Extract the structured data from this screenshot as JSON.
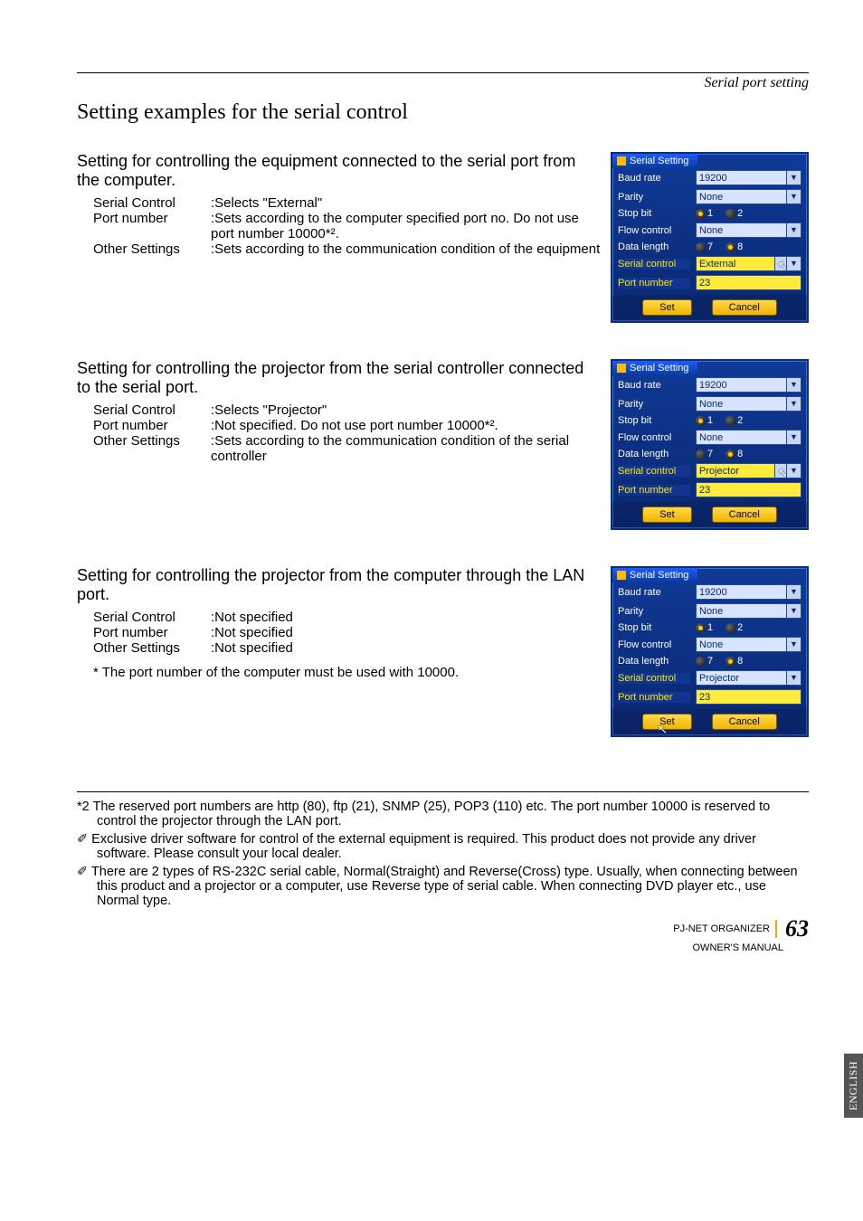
{
  "breadcrumb": "Serial port setting",
  "main_heading": "Setting examples for the serial control",
  "side_tab": "ENGLISH",
  "sections": [
    {
      "heading": "Setting for controlling the equipment connected to the serial port from the computer.",
      "rows": [
        {
          "label": "Serial Control",
          "value": ":Selects \"External\""
        },
        {
          "label": "Port number",
          "value": ":Sets according to the computer specified port no. Do not use port number 10000*²."
        },
        {
          "label": "Other Settings",
          "value": ":Sets according to the communication condition of the equipment"
        }
      ],
      "panel": {
        "serial_control_value": "External",
        "serial_control_hl": true,
        "serial_control_split": true,
        "port_number_hl": true,
        "port_number_value": "23",
        "baud_rate": "19200",
        "parity": "None",
        "stop_bit_sel": "1",
        "flow_control": "None",
        "data_length_sel": "8",
        "hl_labels": [
          "Serial control",
          "Port number"
        ],
        "cursor_on": "serial_control",
        "set_cursor": false
      }
    },
    {
      "heading": "Setting for controlling the projector from the serial controller connected to the serial port.",
      "rows": [
        {
          "label": "Serial Control",
          "value": ":Selects \"Projector\""
        },
        {
          "label": "Port number",
          "value": ":Not specified. Do not use port number 10000*²."
        },
        {
          "label": "Other Settings",
          "value": ":Sets according to the communication condition of the serial controller"
        }
      ],
      "panel": {
        "serial_control_value": "Projector",
        "serial_control_hl": true,
        "serial_control_split": true,
        "port_number_hl": true,
        "port_number_value": "23",
        "baud_rate": "19200",
        "parity": "None",
        "stop_bit_sel": "1",
        "flow_control": "None",
        "data_length_sel": "8",
        "hl_labels": [
          "Serial control",
          "Port number"
        ],
        "cursor_on": "serial_control",
        "set_cursor": false
      }
    },
    {
      "heading": "Setting for controlling the projector from the computer through the LAN port.",
      "rows": [
        {
          "label": "Serial Control",
          "value": ":Not specified"
        },
        {
          "label": "Port number",
          "value": ":Not specified"
        },
        {
          "label": "Other Settings",
          "value": ":Not specified"
        }
      ],
      "footnote": "* The port number of the computer must be used with 10000.",
      "panel": {
        "serial_control_value": "Projector",
        "serial_control_hl": false,
        "serial_control_split": false,
        "port_number_hl": true,
        "port_number_value": "23",
        "baud_rate": "19200",
        "parity": "None",
        "stop_bit_sel": "1",
        "flow_control": "None",
        "data_length_sel": "8",
        "hl_labels": [
          "Serial control",
          "Port number"
        ],
        "cursor_on": "set",
        "set_cursor": true
      }
    }
  ],
  "panel_labels": {
    "title": "Serial Setting",
    "baud_rate": "Baud rate",
    "parity": "Parity",
    "stop_bit": "Stop bit",
    "flow_control": "Flow control",
    "data_length": "Data length",
    "serial_control": "Serial control",
    "port_number": "Port number",
    "set": "Set",
    "cancel": "Cancel",
    "opt1": "1",
    "opt2": "2",
    "opt7": "7",
    "opt8": "8"
  },
  "notes": [
    "*2 The reserved port numbers are http (80), ftp (21), SNMP (25), POP3 (110) etc. The port number 10000 is reserved to control the projector through the LAN port.",
    "✐ Exclusive driver software for control of the external equipment is required. This product does not provide any driver software. Please consult your local dealer.",
    "✐ There are 2 types of RS-232C serial cable, Normal(Straight) and Reverse(Cross) type. Usually, when connecting between this product and a projector or a computer, use Reverse type of serial cable. When connecting DVD player etc., use Normal type."
  ],
  "footer": {
    "line1": "PJ-NET ORGANIZER",
    "line2": "OWNER'S MANUAL",
    "page": "63"
  }
}
